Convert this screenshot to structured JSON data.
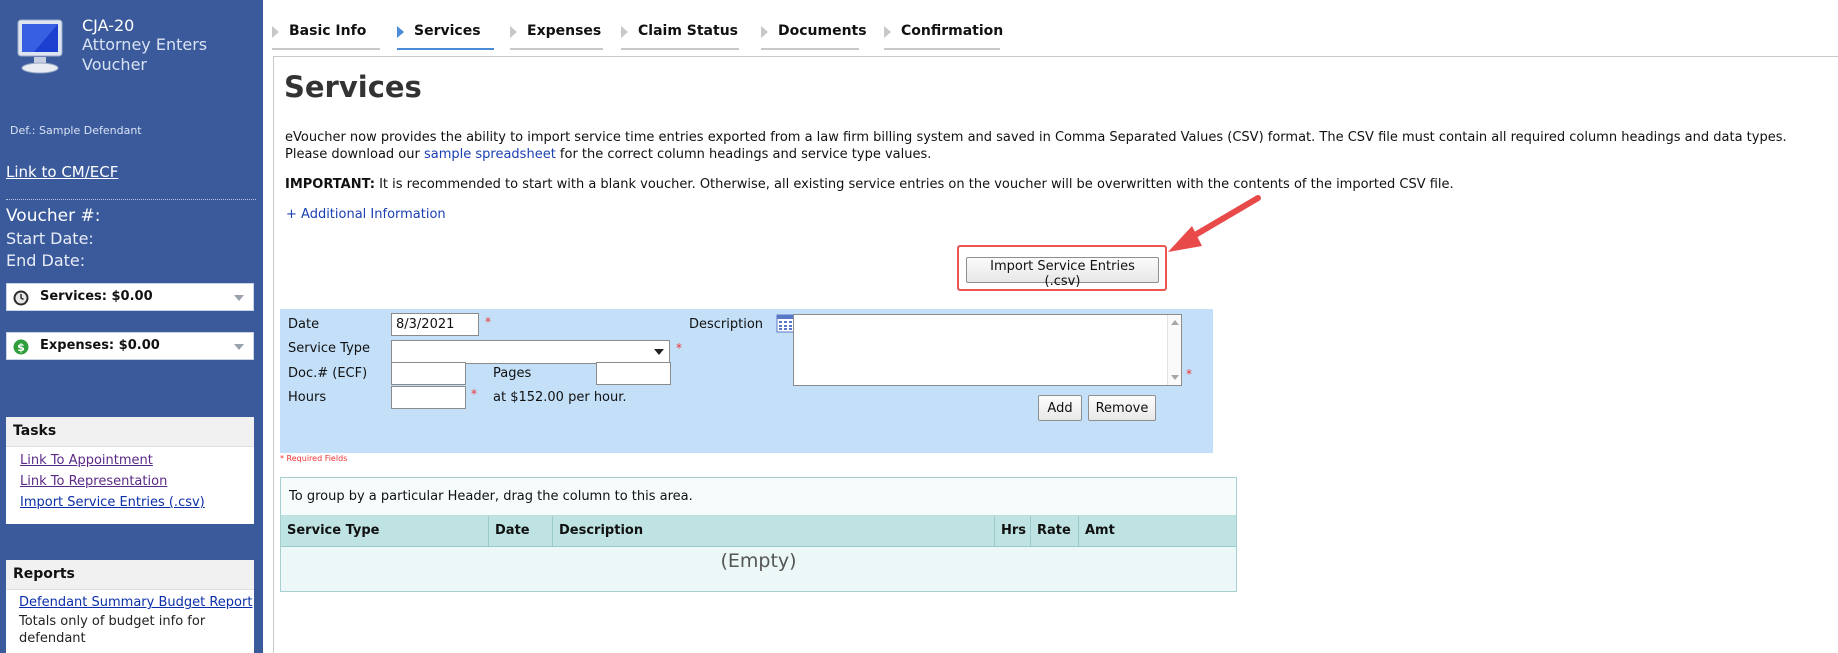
{
  "sidebar": {
    "form_code": "CJA-20",
    "form_name": "Attorney Enters Voucher",
    "defendant": "Def.: Sample Defendant",
    "cmecf_link": "Link to CM/ECF",
    "voucher_label": "Voucher #:",
    "start_date_label": "Start Date:",
    "end_date_label": "End Date:",
    "services_summary": "Services: $0.00",
    "expenses_summary": "Expenses: $0.00",
    "tasks": {
      "title": "Tasks",
      "items": [
        "Link To Appointment",
        "Link To Representation",
        "Import Service Entries (.csv)"
      ]
    },
    "reports": {
      "title": "Reports",
      "link": "Defendant Summary Budget Report",
      "description": "Totals only of budget info for defendant"
    }
  },
  "tabs": [
    {
      "label": "Basic Info"
    },
    {
      "label": "Services"
    },
    {
      "label": "Expenses"
    },
    {
      "label": "Claim Status"
    },
    {
      "label": "Documents"
    },
    {
      "label": "Confirmation"
    }
  ],
  "active_tab": "Services",
  "main": {
    "title": "Services",
    "intro_text_1": "eVoucher now provides the ability to import service time entries exported from a law firm billing system and saved in Comma Separated Values (CSV) format. The CSV file must contain all required column headings and data types. Please download our ",
    "intro_link": "sample spreadsheet",
    "intro_text_2": " for the correct column headings and service type values.",
    "important_label": "IMPORTANT:",
    "important_text": " It is recommended to start with a blank voucher. Otherwise, all existing service entries on the voucher will be overwritten with the contents of the imported CSV file.",
    "additional_info": "+ Additional Information",
    "import_button": "Import Service Entries (.csv)"
  },
  "entry_form": {
    "date_label": "Date",
    "date_value": "8/3/2021",
    "service_type_label": "Service Type",
    "service_type_value": "",
    "doc_label": "Doc.# (ECF)",
    "doc_value": "",
    "pages_label": "Pages",
    "pages_value": "",
    "hours_label": "Hours",
    "hours_value": "",
    "rate_text": "at $152.00 per hour.",
    "description_label": "Description",
    "description_value": "",
    "add_button": "Add",
    "remove_button": "Remove",
    "required_marker": "*",
    "required_note": "* Required Fields"
  },
  "grid": {
    "group_hint": "To group by a particular Header, drag the column to this area.",
    "columns": [
      "Service Type",
      "Date",
      "Description",
      "Hrs",
      "Rate",
      "Amt"
    ],
    "empty_text": "(Empty)"
  },
  "colors": {
    "sidebar_bg": "#3a5a9c",
    "tab_active": "#4a8ad6",
    "entry_bg": "#c4e0f9",
    "grid_header": "#bfe3e3",
    "highlight": "#e55555",
    "required": "#e33333"
  },
  "icons": [
    "monitor-icon",
    "clock-icon",
    "dollar-icon",
    "calendar-icon",
    "red-arrow-annotation"
  ]
}
